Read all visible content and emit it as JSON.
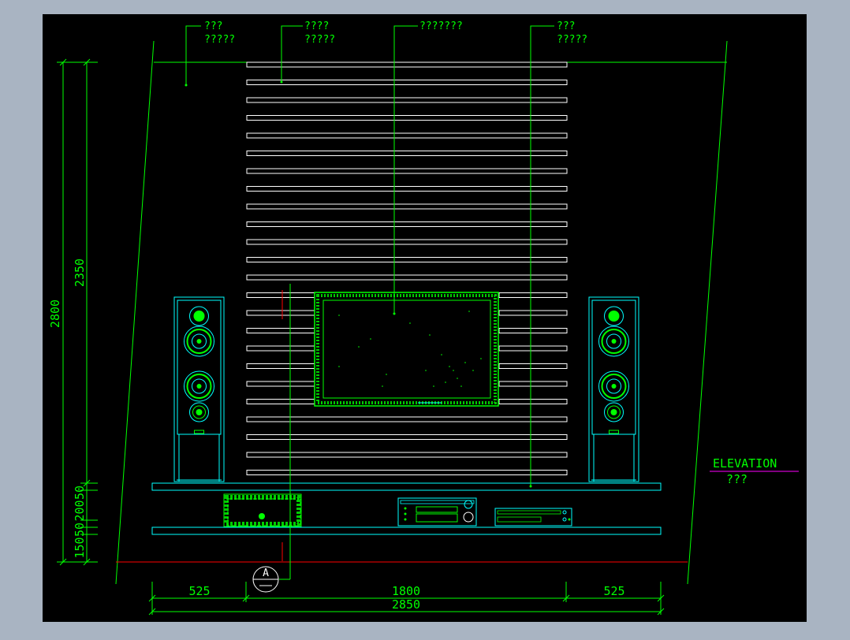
{
  "colors": {
    "window_bg": "#a9b4c2",
    "canvas_bg": "#000000",
    "green": "#00ff00",
    "cyan": "#00ffff",
    "white": "#ffffff",
    "red": "#ff0000",
    "magenta": "#ff00ff"
  },
  "callouts": [
    {
      "line1": "???",
      "line2": "?????"
    },
    {
      "line1": "????",
      "line2": "?????"
    },
    {
      "line1": "???????",
      "line2": ""
    },
    {
      "line1": "???",
      "line2": "?????"
    }
  ],
  "elevation": {
    "title": "ELEVATION",
    "subtitle": "???"
  },
  "section_marker": {
    "letter": "A"
  },
  "dimensions": {
    "vertical_outer": "2800",
    "vertical_upper": "2350",
    "vertical_small": [
      "50",
      "200",
      "50",
      "150",
      "50"
    ],
    "horizontal_left": "525",
    "horizontal_middle": "1800",
    "horizontal_right": "525",
    "horizontal_total": "2850"
  },
  "icons": {
    "left_speaker": "tower-speaker-icon",
    "right_speaker": "tower-speaker-icon",
    "tv": "tv-screen-icon",
    "receiver": "av-receiver-icon",
    "dvd": "dvd-player-icon",
    "subwoofer": "subwoofer-box-icon"
  }
}
